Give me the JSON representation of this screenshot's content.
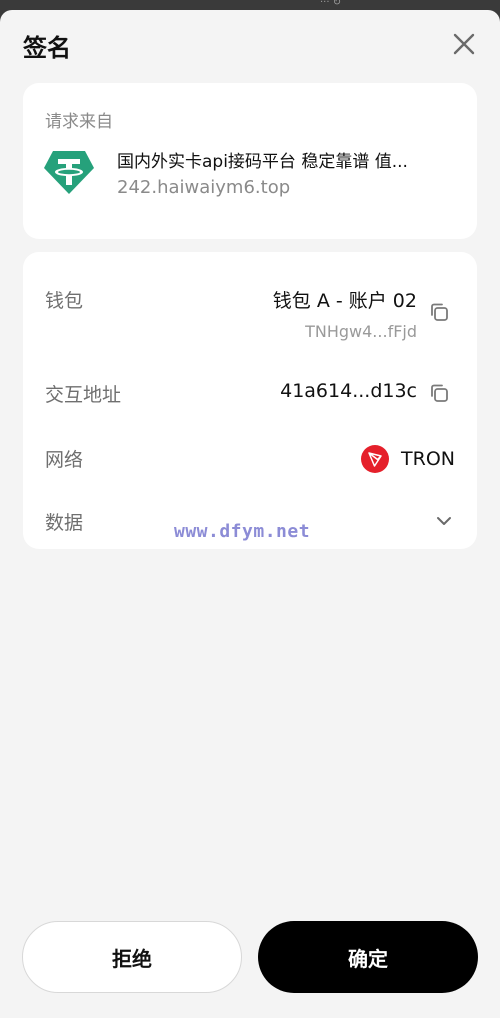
{
  "status_bar": {
    "glyph": "··· ↻"
  },
  "sheet": {
    "title": "签名",
    "close_icon": "close-icon"
  },
  "origin": {
    "label": "请求来自",
    "logo_icon": "tether-icon",
    "logo_color": "#26a17b",
    "name": "国内外实卡api接码平台 稳定靠谱 值...",
    "url": "242.haiwaiym6.top"
  },
  "details": {
    "wallet": {
      "label": "钱包",
      "value": "钱包 A - 账户 02",
      "address": "TNHgw4...fFjd"
    },
    "contract": {
      "label": "交互地址",
      "value": "41a614...d13c"
    },
    "network": {
      "label": "网络",
      "value": "TRON",
      "icon": "tron-icon",
      "icon_color": "#e5202b"
    },
    "data": {
      "label": "数据",
      "expand_icon": "chevron-down-icon"
    }
  },
  "watermark": "www.dfym.net",
  "actions": {
    "reject_label": "拒绝",
    "confirm_label": "确定"
  }
}
